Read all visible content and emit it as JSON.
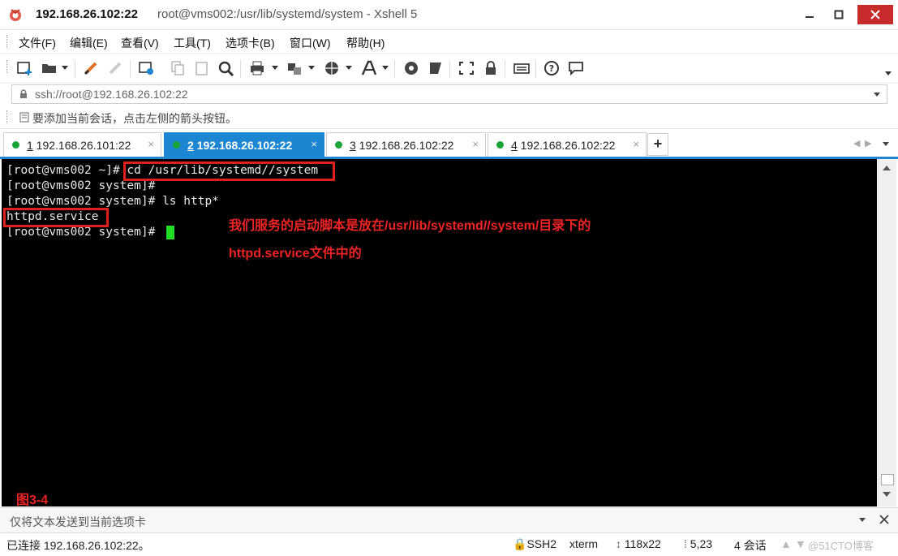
{
  "window": {
    "title_host": "192.168.26.102:22",
    "title_detail": "root@vms002:/usr/lib/systemd/system - Xshell 5"
  },
  "menu": [
    "文件(F)",
    "编辑(E)",
    "查看(V)",
    "工具(T)",
    "选项卡(B)",
    "窗口(W)",
    "帮助(H)"
  ],
  "address": {
    "value": "ssh://root@192.168.26.102:22"
  },
  "hint": "要添加当前会话，点击左侧的箭头按钮。",
  "tabs": [
    {
      "num": "1",
      "label": " 192.168.26.101:22",
      "close": "×"
    },
    {
      "num": "2",
      "label": " 192.168.26.102:22",
      "close": "×"
    },
    {
      "num": "3",
      "label": " 192.168.26.102:22",
      "close": "×"
    },
    {
      "num": "4",
      "label": " 192.168.26.102:22",
      "close": "×"
    }
  ],
  "tab_add": "+",
  "terminal": {
    "lines": [
      {
        "prompt": "[root@vms002 ~]# ",
        "cmd": "cd /usr/lib/systemd//system"
      },
      {
        "prompt": "[root@vms002 system]#",
        "cmd": ""
      },
      {
        "prompt": "[root@vms002 system]# ",
        "cmd": "ls http*"
      },
      {
        "prompt": "",
        "cmd": "httpd.service"
      },
      {
        "prompt": "[root@vms002 system]# ",
        "cmd": ""
      }
    ],
    "annotation_line1": "我们服务的启动脚本是放在/usr/lib/systemd//system/目录下的",
    "annotation_line2": "httpd.service文件中的",
    "figure_label": "图3-4",
    "cursor_color": "#22dd22"
  },
  "send_bar": "仅将文本发送到当前选项卡",
  "status": {
    "connection": "已连接 192.168.26.102:22。",
    "protocol": "SSH2",
    "term": "xterm",
    "size": "118x22",
    "position": "5,23",
    "sessions": "4 会话",
    "watermark": "@51CTO博客"
  },
  "colors": {
    "accent": "#1c86d3",
    "annotation": "#e0201e",
    "active_dot": "#1aa53a"
  }
}
